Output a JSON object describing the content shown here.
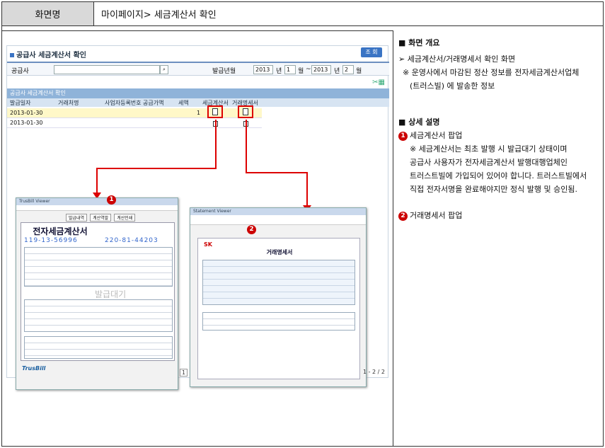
{
  "header": {
    "label": "화면명",
    "title": "마이페이지> 세금계산서 확인"
  },
  "app": {
    "title": "공급사 세금계산서 확인",
    "search_button": "조 회",
    "search": {
      "supplier_label": "공급사",
      "issue_date_label": "발급년월",
      "from_year": "2013",
      "from_month": "1",
      "to_year": "2013",
      "to_month": "2",
      "year_unit": "년",
      "month_unit": "월",
      "range_sep": "~"
    },
    "grid_title": "공급사 세금계산서 확인",
    "columns": [
      "발급일자",
      "거래처명",
      "사업자등록번호",
      "공급가액",
      "세액",
      "세금계산서",
      "거래명세서"
    ],
    "rows": [
      {
        "date": "2013-01-30",
        "count": "1"
      },
      {
        "date": "2013-01-30",
        "count": ""
      }
    ],
    "pager": "1 - 2 / 2",
    "pager_page": "1"
  },
  "popup1": {
    "title": "전자세금계산서",
    "tabs": [
      "발급내역",
      "계산역발",
      "계산인쇄"
    ],
    "reg_no_1": "119-13-56996",
    "reg_no_2": "220-81-44203",
    "status": "발급대기",
    "brand": "TrusBill",
    "marker": "1"
  },
  "popup2": {
    "title": "거래명세서",
    "brand": "SK",
    "marker": "2"
  },
  "desc": {
    "overview_title": "■ 화면 개요",
    "overview_line1": "➢ 세금계산서/거래명세서 확인 화면",
    "overview_line2": "※ 운영사에서 마감된 정산 정보를 전자세금계산서업체",
    "overview_line3": "(트러스빌) 에 발송한 정보",
    "detail_title": "■ 상세 설명",
    "item1_num": "1",
    "item1_label": "세금계산서 팝업",
    "item1_note1": "※ 세금계산서는 최초 발행 시 발급대기 상태이며",
    "item1_note2": "공급사 사용자가 전자세금계산서 발행대행업체인",
    "item1_note3": "트러스트빌에 가입되어 있어야 합니다. 트러스트빌에서",
    "item1_note4": "직접 전자서명을 완료해야지만 정식 발행 및 승인됨.",
    "item2_num": "2",
    "item2_label": "거래명세서 팝업"
  },
  "colors": {
    "accent": "#3a74c4",
    "highlight_border": "#dd0000",
    "highlight_row": "#fff8c8"
  }
}
